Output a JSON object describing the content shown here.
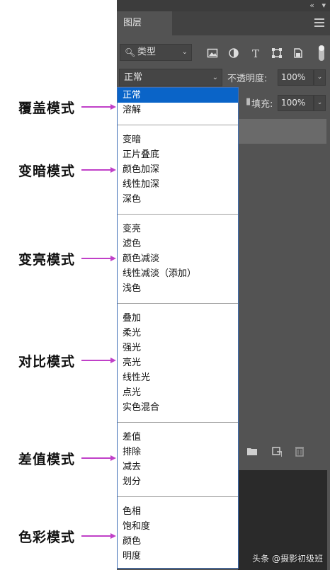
{
  "annotations": {
    "normal": "覆盖模式",
    "darken": "变暗模式",
    "lighten": "变亮模式",
    "contrast": "对比模式",
    "difference": "差值模式",
    "color": "色彩模式"
  },
  "panel": {
    "tab": "图层",
    "filter": {
      "label": "类型"
    },
    "blend_mode": "正常",
    "opacity": {
      "label": "不透明度:",
      "value": "100%"
    },
    "fill": {
      "label": "填充:",
      "value": "100%"
    }
  },
  "dropdown": {
    "groups": [
      [
        "正常",
        "溶解"
      ],
      [
        "变暗",
        "正片叠底",
        "颜色加深",
        "线性加深",
        "深色"
      ],
      [
        "变亮",
        "滤色",
        "颜色减淡",
        "线性减淡（添加）",
        "浅色"
      ],
      [
        "叠加",
        "柔光",
        "强光",
        "亮光",
        "线性光",
        "点光",
        "实色混合"
      ],
      [
        "差值",
        "排除",
        "减去",
        "划分"
      ],
      [
        "色相",
        "饱和度",
        "颜色",
        "明度"
      ]
    ]
  },
  "watermark": "头条 @摄影初级班",
  "colors": {
    "annotation_arrow": "#c040c8",
    "selected_bg": "#0a64c8",
    "panel_bg": "#535353"
  }
}
